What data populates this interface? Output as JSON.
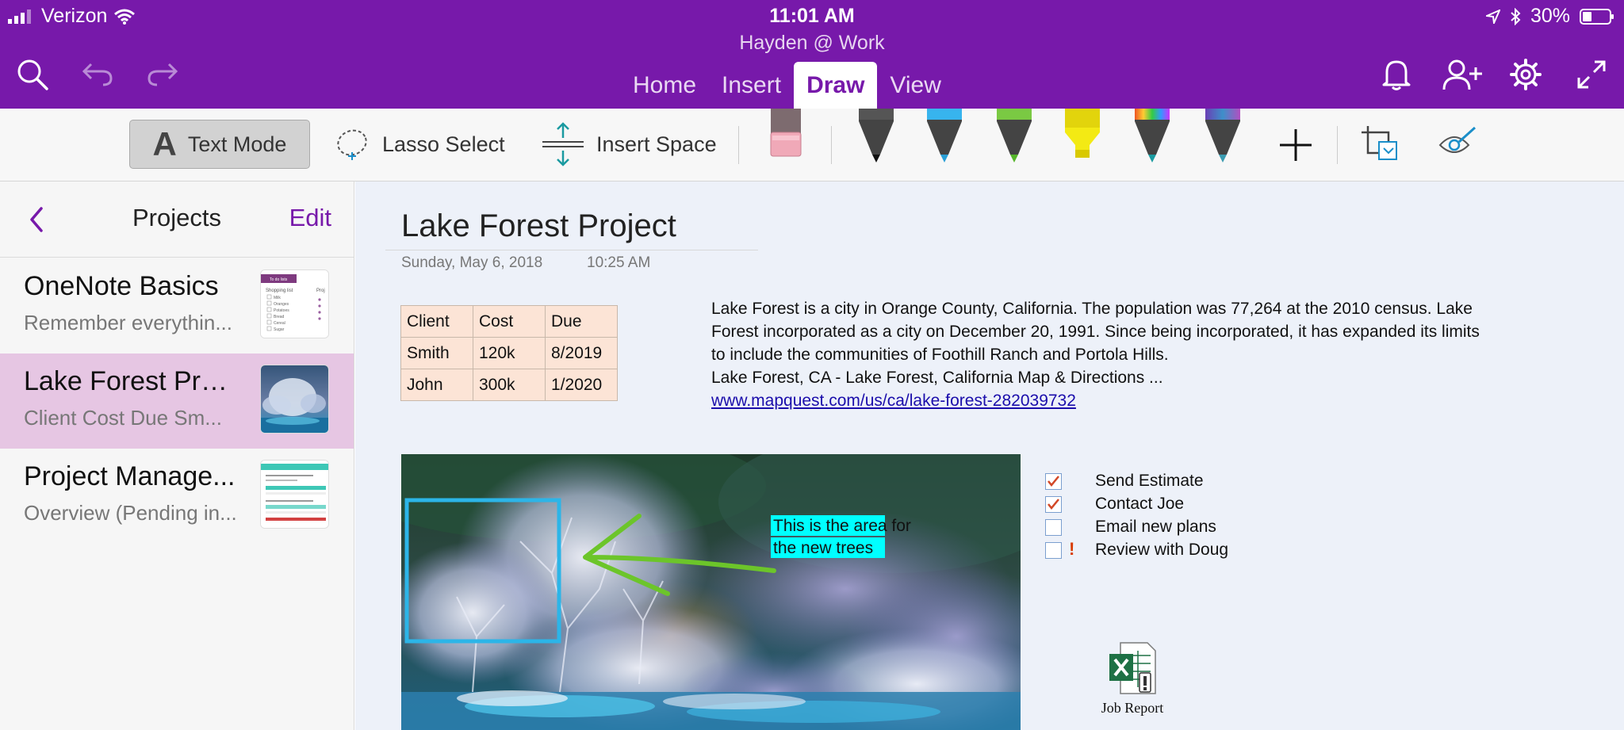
{
  "status": {
    "carrier": "Verizon",
    "time": "11:01 AM",
    "battery": "30%"
  },
  "notebook_title": "Hayden @ Work",
  "tabs": [
    "Home",
    "Insert",
    "Draw",
    "View"
  ],
  "active_tab": "Draw",
  "toolbar": {
    "text_mode": "Text Mode",
    "text_mode_glyph": "A",
    "lasso_select": "Lasso Select",
    "insert_space": "Insert Space"
  },
  "sidebar": {
    "title": "Projects",
    "edit": "Edit",
    "pages": [
      {
        "title": "OneNote Basics",
        "subtitle": "Remember everythin..."
      },
      {
        "title": "Lake Forest Proj...",
        "subtitle": "Client Cost Due Sm..."
      },
      {
        "title": "Project Manage...",
        "subtitle": "Overview (Pending in..."
      }
    ],
    "thumb1_mini": {
      "header": "To do lists",
      "list_title": "Shopping list",
      "items": [
        "Milk",
        "Oranges",
        "Potatoes",
        "Bread",
        "Cereal",
        "Sugar"
      ],
      "col2": "Proj"
    }
  },
  "page": {
    "title": "Lake Forest Project",
    "date": "Sunday, May 6, 2018",
    "time": "10:25 AM",
    "table": {
      "headers": [
        "Client",
        "Cost",
        "Due"
      ],
      "rows": [
        [
          "Smith",
          "120k",
          "8/2019"
        ],
        [
          "John",
          "300k",
          "1/2020"
        ]
      ]
    },
    "description": {
      "line1": "Lake Forest is a city in Orange County, California. The population was 77,264 at the 2010 census. Lake",
      "line2": "Forest incorporated as a city on December 20, 1991. Since being incorporated, it has expanded its limits",
      "line3": "to include the communities of Foothill Ranch and Portola Hills.",
      "line4": "Lake Forest, CA - Lake Forest, California Map & Directions ...",
      "link": "www.mapquest.com/us/ca/lake-forest-282039732"
    },
    "image_note": {
      "line1": "This is the area for",
      "line2": "the new trees"
    },
    "todos": [
      {
        "text": "Send Estimate",
        "checked": true,
        "important": false
      },
      {
        "text": "Contact Joe",
        "checked": true,
        "important": false
      },
      {
        "text": "Email new plans",
        "checked": false,
        "important": false
      },
      {
        "text": "Review with Doug",
        "checked": false,
        "important": true
      }
    ],
    "important_mark": "!",
    "attachment": {
      "label": "Job Report"
    }
  },
  "colors": {
    "brand_purple": "#7719aa",
    "selected_page": "#e6c6e3",
    "table_fill": "#fce4d6",
    "highlight_cyan": "#00ffff",
    "ink_green": "#6cc52a",
    "ink_blue": "#2cb5e8",
    "check_orange": "#d24726"
  },
  "pens": [
    "pen-black",
    "pen-blue",
    "pen-green",
    "highlighter-yellow",
    "pen-rainbow",
    "pen-galaxy"
  ]
}
